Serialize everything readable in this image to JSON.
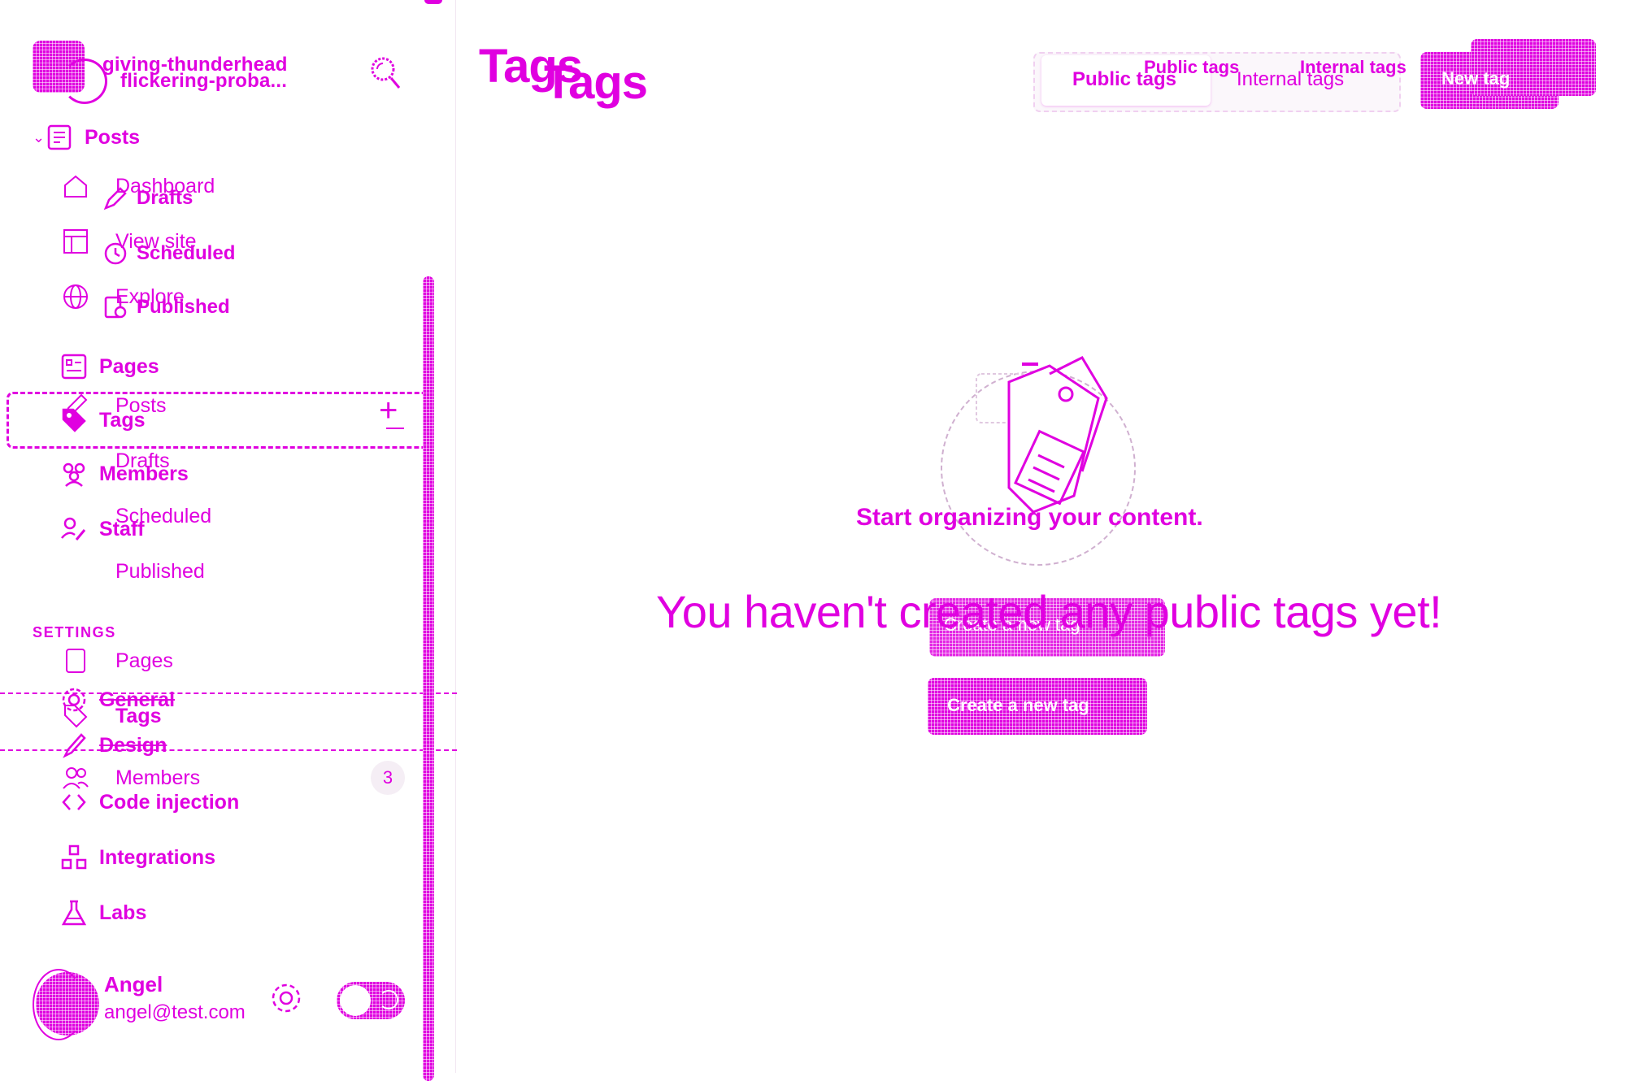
{
  "site": {
    "name_primary": "giving-thunderhead",
    "name_secondary": "flickering-proba..."
  },
  "nav": {
    "posts_label": "Posts",
    "posts_sub": [
      {
        "label": "Drafts",
        "icon": "pencil-icon"
      },
      {
        "label": "Scheduled",
        "icon": "clock-icon"
      },
      {
        "label": "Published",
        "icon": "published-icon"
      }
    ],
    "ghost_items": [
      {
        "label": "Dashboard",
        "icon": "home-icon"
      },
      {
        "label": "View site",
        "icon": "layout-icon"
      },
      {
        "label": "Explore",
        "icon": "globe-icon"
      },
      {
        "label": "Posts",
        "icon": "edit-icon"
      },
      {
        "label": "Drafts",
        "icon": ""
      },
      {
        "label": "Scheduled",
        "icon": ""
      },
      {
        "label": "Published",
        "icon": ""
      },
      {
        "label": "Pages",
        "icon": "page-icon"
      },
      {
        "label": "Tags",
        "icon": "tag-icon"
      },
      {
        "label": "Members",
        "icon": "members-icon"
      }
    ],
    "members_count": "3",
    "pages_label": "Pages",
    "tags_label": "Tags",
    "members_label": "Members",
    "staff_label": "Staff"
  },
  "settings": {
    "heading": "SETTINGS",
    "general_label": "General",
    "design_label": "Design",
    "code_injection_label": "Code injection",
    "integrations_label": "Integrations",
    "labs_label": "Labs"
  },
  "user": {
    "name": "Angel",
    "email": "angel@test.com"
  },
  "header": {
    "title": "Tags",
    "tabs": {
      "public": "Public tags",
      "internal": "Internal tags"
    },
    "new_tag_label": "New tag"
  },
  "empty_state": {
    "heading": "Start organizing your content.",
    "message": "You haven't created any public tags yet!",
    "ghost_button_label": "Create a new tag",
    "create_button_label": "Create a new tag"
  },
  "colors": {
    "accent": "#e000e0",
    "background": "#ffffff"
  }
}
